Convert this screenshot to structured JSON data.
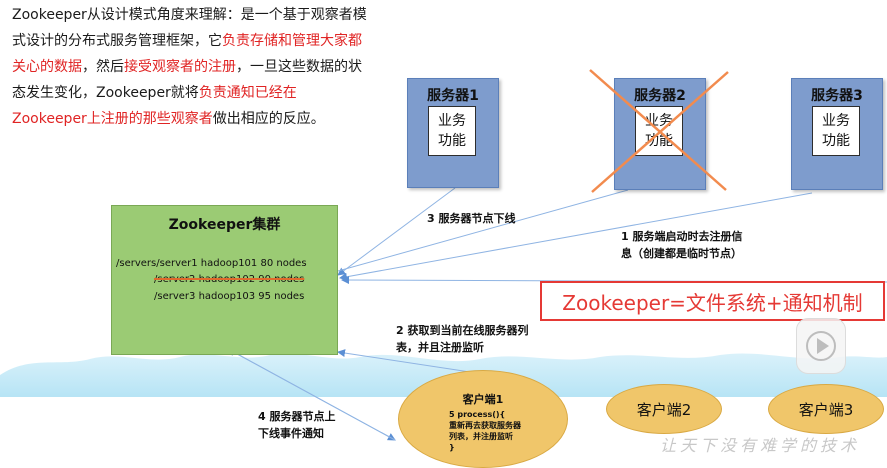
{
  "intro": {
    "p1": "Zookeeper从设计模式角度来理解：是一个基于观察者模式设计的分布式服务管理框架，它",
    "p1_red": "负责存储和管理大家都关心的数据",
    "p2": "，然后",
    "p2_red": "接受观察者的注册",
    "p3": "，一旦这些数据的状态发生变化，Zookeeper就将",
    "p3_red": "负责通知已经在Zookeeper上注册的那些观察者",
    "p4": "做出相应的反应。"
  },
  "servers": [
    {
      "title": "服务器1",
      "func_line1": "业务",
      "func_line2": "功能"
    },
    {
      "title": "服务器2",
      "func_line1": "业务",
      "func_line2": "功能"
    },
    {
      "title": "服务器3",
      "func_line1": "业务",
      "func_line2": "功能"
    }
  ],
  "zookeeper": {
    "title": "Zookeeper集群",
    "nodes": [
      "/servers/server1  hadoop101  80 nodes",
      "/server2  hadoop102  90 nodes",
      "/server3  hadoop103  95 nodes"
    ]
  },
  "labels": {
    "step3": "3 服务器节点下线",
    "step1_line1": "1  服务端启动时去注册信",
    "step1_line2": "息（创建都是临时节点）",
    "step2_line1": "2  获取到当前在线服务器列",
    "step2_line2": "表，并且注册监听",
    "step4_line1": "4  服务器节点上",
    "step4_line2": "下线事件通知"
  },
  "formula": "Zookeeper=文件系统+通知机制",
  "clients": {
    "c1_title": "客户端1",
    "c1_code_1": "5 process(){",
    "c1_code_2": "重新再去获取服务器",
    "c1_code_3": "列表，并注册监听",
    "c1_code_4": "}",
    "c2_title": "客户端2",
    "c3_title": "客户端3"
  },
  "watermark": "让天下没有难学的技术",
  "colors": {
    "server_fill": "#7e9ccd",
    "zookeeper_fill": "#9bcb74",
    "client_fill": "#f0c66a",
    "cross": "#f28b4e",
    "highlight_red": "#e02424",
    "arrow": "#5b8fd4"
  },
  "icons": {
    "cross": "cross-mark-icon",
    "play": "play-icon",
    "cloud": "cloud-band"
  }
}
